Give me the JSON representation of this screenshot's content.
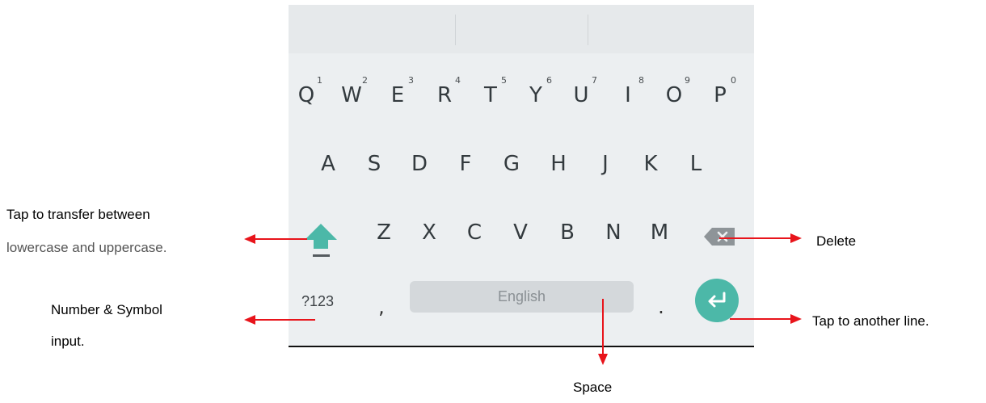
{
  "keyboard": {
    "row1": [
      {
        "letter": "Q",
        "hint": "1"
      },
      {
        "letter": "W",
        "hint": "2"
      },
      {
        "letter": "E",
        "hint": "3"
      },
      {
        "letter": "R",
        "hint": "4"
      },
      {
        "letter": "T",
        "hint": "5"
      },
      {
        "letter": "Y",
        "hint": "6"
      },
      {
        "letter": "U",
        "hint": "7"
      },
      {
        "letter": "I",
        "hint": "8"
      },
      {
        "letter": "O",
        "hint": "9"
      },
      {
        "letter": "P",
        "hint": "0"
      }
    ],
    "row2": [
      "A",
      "S",
      "D",
      "F",
      "G",
      "H",
      "J",
      "K",
      "L"
    ],
    "row3": [
      "Z",
      "X",
      "C",
      "V",
      "B",
      "N",
      "M"
    ],
    "symbols_label": "?123",
    "comma": ",",
    "period": ".",
    "space_label": "English",
    "accent_color": "#4cb8a8",
    "icons": {
      "shift": "shift-arrow-up-icon",
      "backspace": "backspace-icon",
      "enter": "enter-return-icon"
    }
  },
  "annotations": {
    "shift_line1": "Tap  to  transfer  between",
    "shift_line2": "lowercase and uppercase.",
    "symbol_line1": "Number & Symbol",
    "symbol_line2": "input.",
    "delete": "Delete",
    "enter": "Tap to another line.",
    "space": "Space",
    "arrow_color": "#e8141b"
  }
}
